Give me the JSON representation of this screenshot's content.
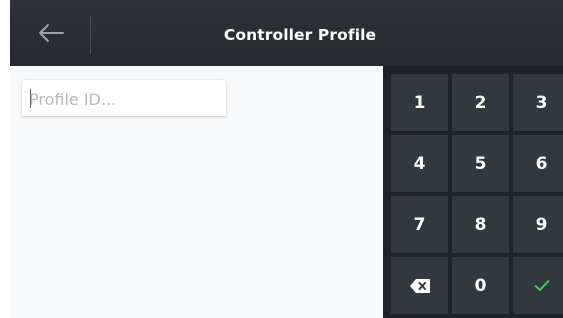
{
  "header": {
    "title": "Controller Profile",
    "back_icon": "arrow-left-icon"
  },
  "form": {
    "profile_id": {
      "value": "",
      "placeholder": "Profile ID..."
    }
  },
  "keypad": {
    "keys": [
      "1",
      "2",
      "3",
      "4",
      "5",
      "6",
      "7",
      "8",
      "9",
      "0"
    ],
    "backspace_icon": "backspace-icon",
    "confirm_icon": "checkmark-icon"
  },
  "colors": {
    "header_bg": "#2b2f34",
    "keypad_bg": "#1f2328",
    "key_bg": "#323840",
    "confirm_accent": "#3ccf4e",
    "content_bg": "#f8f9fa"
  }
}
